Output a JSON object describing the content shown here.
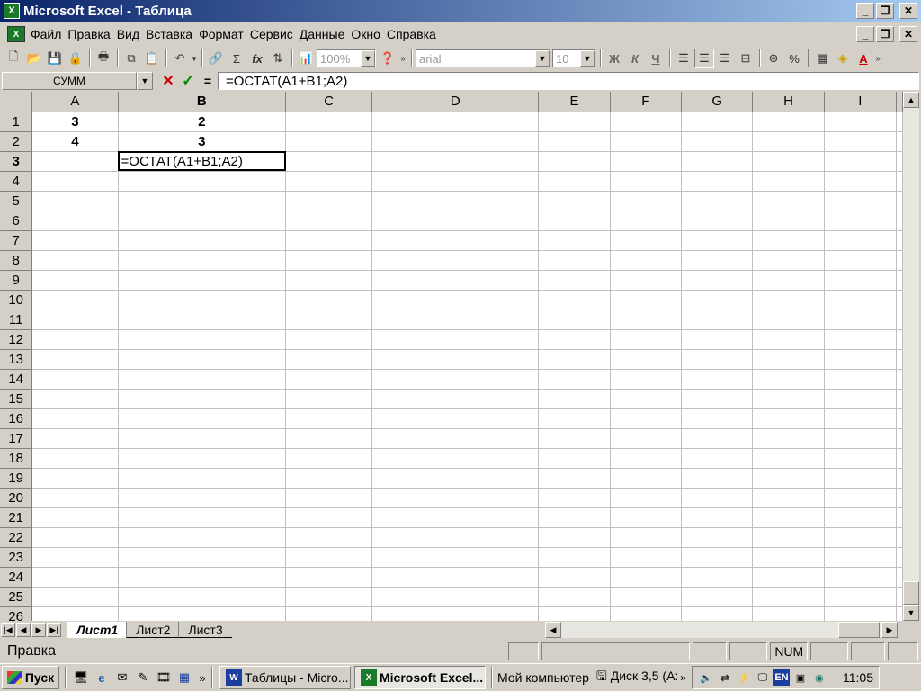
{
  "window": {
    "title": "Microsoft Excel - Таблица",
    "app_icon": "excel-icon"
  },
  "menu": {
    "items": [
      "Файл",
      "Правка",
      "Вид",
      "Вставка",
      "Формат",
      "Сервис",
      "Данные",
      "Окно",
      "Справка"
    ]
  },
  "toolbar": {
    "zoom": "100%",
    "font": "arial",
    "font_size": "10",
    "bold": "Ж",
    "italic": "К",
    "underline": "Ч",
    "sum": "Σ",
    "function": "fx",
    "percent": "%"
  },
  "formula_bar": {
    "name_box": "СУММ",
    "cancel": "✕",
    "enter": "✓",
    "equals": "=",
    "content": "=ОСТАТ(A1+B1;A2)"
  },
  "grid": {
    "columns": [
      "A",
      "B",
      "C",
      "D",
      "E",
      "F",
      "G",
      "H",
      "I"
    ],
    "rows": [
      "1",
      "2",
      "3",
      "4",
      "5",
      "6",
      "7",
      "8",
      "9",
      "10",
      "11",
      "12",
      "13",
      "14",
      "15",
      "16",
      "17",
      "18",
      "19",
      "20",
      "21",
      "22",
      "23",
      "24",
      "25",
      "26"
    ],
    "cells": {
      "A1": "3",
      "B1": "2",
      "A2": "4",
      "B2": "3",
      "B3": "=ОСТАТ(A1+B1;A2)"
    },
    "active_row": "3",
    "active_col": "B"
  },
  "sheets": [
    "Лист1",
    "Лист2",
    "Лист3"
  ],
  "status": {
    "text": "Правка",
    "num": "NUM"
  },
  "taskbar": {
    "start": "Пуск",
    "tasks": [
      "Таблицы - Micro...",
      "Microsoft Excel..."
    ],
    "tray_items": [
      "Мой компьютер",
      "Диск 3,5 (A:"
    ],
    "lang": "EN",
    "clock": "11:05"
  }
}
